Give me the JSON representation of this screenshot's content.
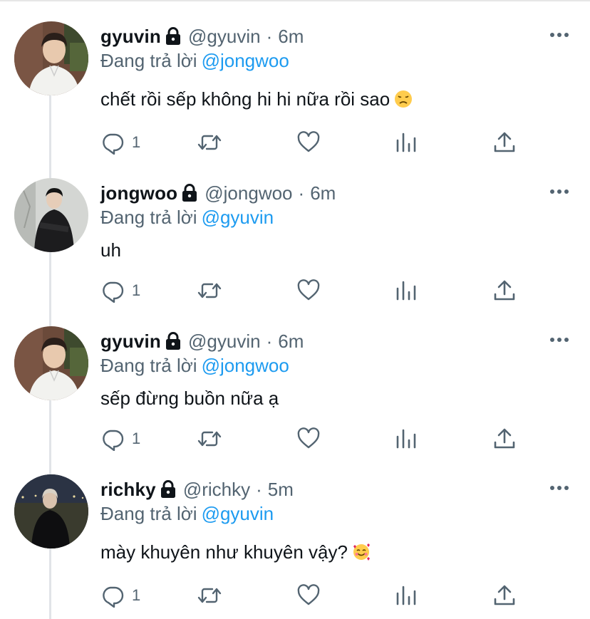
{
  "colors": {
    "accent": "#1d9bf0",
    "secondary": "#536471",
    "text": "#0f1419",
    "thread_line": "#e1e4e8"
  },
  "tweets": [
    {
      "name": "gyuvin",
      "handle": "@gyuvin",
      "separator": "·",
      "time": "6m",
      "reply_prefix": "Đang trả lời",
      "reply_to": "@jongwoo",
      "text": "chết rồi sếp không hi hi nữa rồi sao",
      "emoji": "disappointed-face",
      "reply_count": "1",
      "protected": true
    },
    {
      "name": "jongwoo",
      "handle": "@jongwoo",
      "separator": "·",
      "time": "6m",
      "reply_prefix": "Đang trả lời",
      "reply_to": "@gyuvin",
      "text": "uh",
      "emoji": "",
      "reply_count": "1",
      "protected": true
    },
    {
      "name": "gyuvin",
      "handle": "@gyuvin",
      "separator": "·",
      "time": "6m",
      "reply_prefix": "Đang trả lời",
      "reply_to": "@jongwoo",
      "text": "sếp đừng buồn nữa ạ",
      "emoji": "",
      "reply_count": "1",
      "protected": true
    },
    {
      "name": "richky",
      "handle": "@richky",
      "separator": "·",
      "time": "5m",
      "reply_prefix": "Đang trả lời",
      "reply_to": "@gyuvin",
      "text": "mày khuyên như khuyên vậy?",
      "emoji": "smiling-face-with-hearts",
      "reply_count": "1",
      "protected": true
    }
  ],
  "icons": {
    "reply": "reply-icon",
    "retweet": "retweet-icon",
    "like": "heart-icon",
    "analytics": "analytics-icon",
    "share": "share-icon",
    "lock": "lock-icon",
    "more": "more-icon"
  }
}
